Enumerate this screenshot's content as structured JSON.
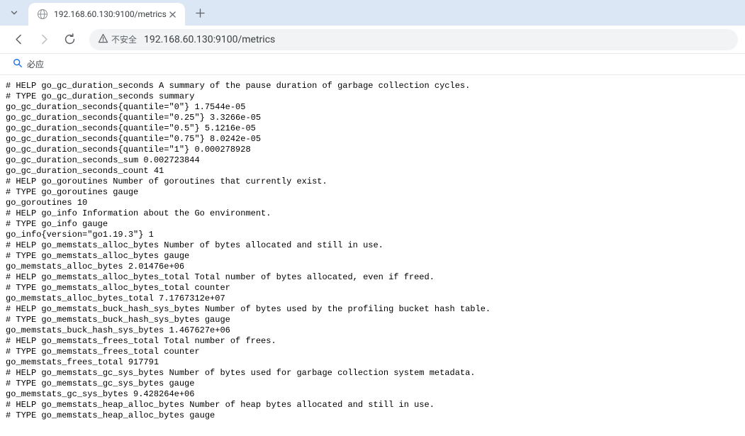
{
  "tab": {
    "title": "192.168.60.130:9100/metrics"
  },
  "security": {
    "label": "不安全"
  },
  "url": "192.168.60.130:9100/metrics",
  "bookmarks": [
    {
      "label": "必应"
    }
  ],
  "metrics_lines": [
    "# HELP go_gc_duration_seconds A summary of the pause duration of garbage collection cycles.",
    "# TYPE go_gc_duration_seconds summary",
    "go_gc_duration_seconds{quantile=\"0\"} 1.7544e-05",
    "go_gc_duration_seconds{quantile=\"0.25\"} 3.3266e-05",
    "go_gc_duration_seconds{quantile=\"0.5\"} 5.1216e-05",
    "go_gc_duration_seconds{quantile=\"0.75\"} 8.0242e-05",
    "go_gc_duration_seconds{quantile=\"1\"} 0.000278928",
    "go_gc_duration_seconds_sum 0.002723844",
    "go_gc_duration_seconds_count 41",
    "# HELP go_goroutines Number of goroutines that currently exist.",
    "# TYPE go_goroutines gauge",
    "go_goroutines 10",
    "# HELP go_info Information about the Go environment.",
    "# TYPE go_info gauge",
    "go_info{version=\"go1.19.3\"} 1",
    "# HELP go_memstats_alloc_bytes Number of bytes allocated and still in use.",
    "# TYPE go_memstats_alloc_bytes gauge",
    "go_memstats_alloc_bytes 2.01476e+06",
    "# HELP go_memstats_alloc_bytes_total Total number of bytes allocated, even if freed.",
    "# TYPE go_memstats_alloc_bytes_total counter",
    "go_memstats_alloc_bytes_total 7.1767312e+07",
    "# HELP go_memstats_buck_hash_sys_bytes Number of bytes used by the profiling bucket hash table.",
    "# TYPE go_memstats_buck_hash_sys_bytes gauge",
    "go_memstats_buck_hash_sys_bytes 1.467627e+06",
    "# HELP go_memstats_frees_total Total number of frees.",
    "# TYPE go_memstats_frees_total counter",
    "go_memstats_frees_total 917791",
    "# HELP go_memstats_gc_sys_bytes Number of bytes used for garbage collection system metadata.",
    "# TYPE go_memstats_gc_sys_bytes gauge",
    "go_memstats_gc_sys_bytes 9.428264e+06",
    "# HELP go_memstats_heap_alloc_bytes Number of heap bytes allocated and still in use.",
    "# TYPE go_memstats_heap_alloc_bytes gauge"
  ]
}
